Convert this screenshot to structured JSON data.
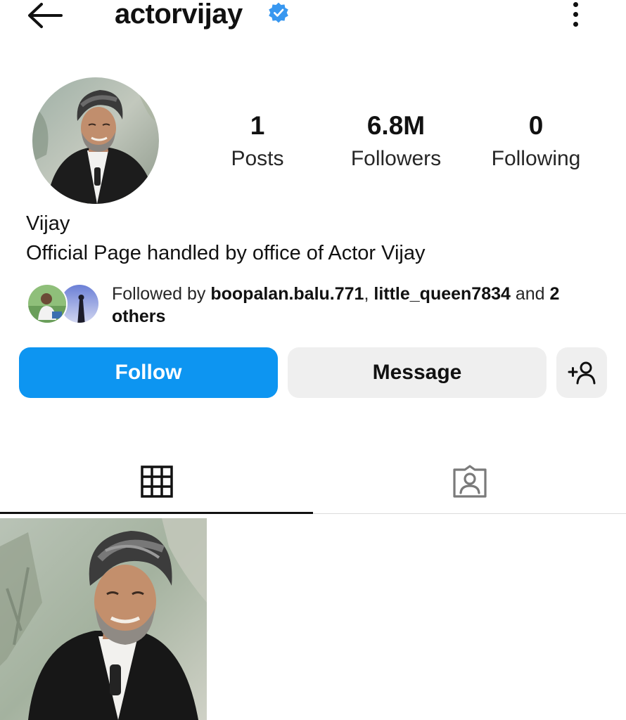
{
  "header": {
    "username": "actorvijay",
    "back_icon": "arrow-left-icon",
    "verified_icon": "verified-badge-icon",
    "more_icon": "more-vertical-icon"
  },
  "profile": {
    "display_name": "Vijay",
    "bio": "Official Page handled by office of Actor Vijay",
    "stats": {
      "posts": {
        "value": "1",
        "label": "Posts"
      },
      "followers": {
        "value": "6.8M",
        "label": "Followers"
      },
      "following": {
        "value": "0",
        "label": "Following"
      }
    }
  },
  "followed_by": {
    "prefix": "Followed by ",
    "user1": "boopalan.balu.771",
    "separator": ", ",
    "user2": "little_queen7834",
    "and_text": " and ",
    "count": "2",
    "suffix": "others"
  },
  "actions": {
    "follow_label": "Follow",
    "message_label": "Message",
    "suggest_icon": "add-person-icon"
  },
  "tabs": [
    {
      "icon": "grid-icon",
      "active": true
    },
    {
      "icon": "tagged-person-icon",
      "active": false
    }
  ],
  "colors": {
    "follow_blue": "#0d95f1",
    "verified_blue": "#3897f0",
    "secondary_button": "#efefef",
    "text": "#111111"
  }
}
